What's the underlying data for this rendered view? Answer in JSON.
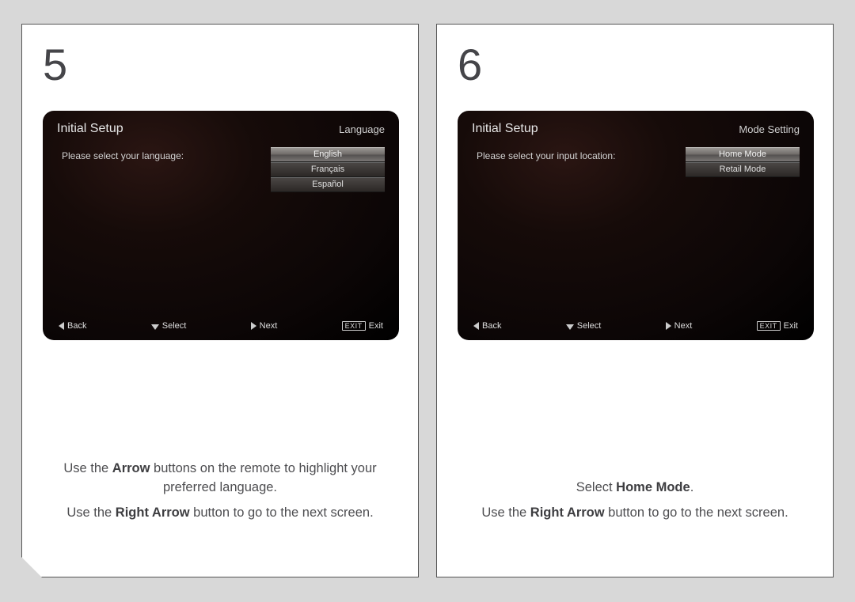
{
  "steps": [
    {
      "number": "5",
      "tv": {
        "title": "Initial Setup",
        "section": "Language",
        "prompt": "Please select your language:",
        "options": [
          "English",
          "Français",
          "Español"
        ],
        "selected_index": 0,
        "hints": {
          "back": "Back",
          "select": "Select",
          "next": "Next",
          "exit_badge": "EXIT",
          "exit": "Exit"
        }
      },
      "instructions": [
        {
          "pre": "Use the ",
          "bold": "Arrow",
          "post": " buttons on the remote to highlight your preferred language."
        },
        {
          "pre": "Use the ",
          "bold": "Right Arrow",
          "post": " button to go to the next screen."
        }
      ]
    },
    {
      "number": "6",
      "tv": {
        "title": "Initial Setup",
        "section": "Mode Setting",
        "prompt": "Please select your input location:",
        "options": [
          "Home Mode",
          "Retail Mode"
        ],
        "selected_index": 0,
        "hints": {
          "back": "Back",
          "select": "Select",
          "next": "Next",
          "exit_badge": "EXIT",
          "exit": "Exit"
        }
      },
      "instructions": [
        {
          "pre": "Select ",
          "bold": "Home Mode",
          "post": "."
        },
        {
          "pre": "Use the ",
          "bold": "Right Arrow",
          "post": " button to go to the next screen."
        }
      ]
    }
  ]
}
